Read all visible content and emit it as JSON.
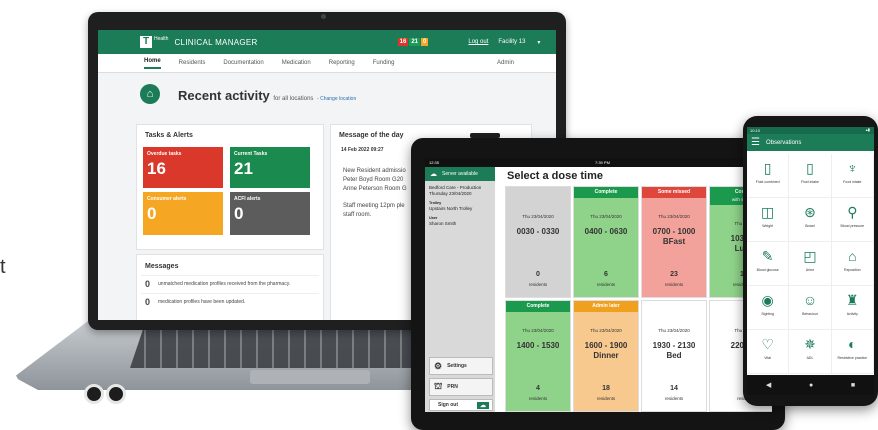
{
  "stray_text": "t",
  "colors": {
    "brand_green": "#1b7c57",
    "red": "#d9382a",
    "orange": "#f5a623",
    "gray": "#5c5c5c",
    "pink": "#f2928a",
    "light_green": "#8fd38a",
    "peach": "#f7c98f",
    "light_gray": "#d3d3d3"
  },
  "laptop": {
    "logo_letter": "T",
    "logo_sup": "Health",
    "app_name": "CLINICAL MANAGER",
    "badges": [
      {
        "text": "16",
        "color": "#d9382a"
      },
      {
        "text": "21",
        "color": "#1b9a5a"
      },
      {
        "text": "0",
        "color": "#f5a623"
      }
    ],
    "logout": "Log out",
    "facility": "Facility 13",
    "nav": [
      "Home",
      "Residents",
      "Documentation",
      "Medication",
      "Reporting",
      "Funding"
    ],
    "admin": "Admin",
    "heading": "Recent activity",
    "heading_sub": "for all locations",
    "change_location": "- Change location",
    "tasks_title": "Tasks & Alerts",
    "tiles": [
      {
        "label": "Overdue tasks",
        "value": "16"
      },
      {
        "label": "Current Tasks",
        "value": "21"
      },
      {
        "label": "Consumer alerts",
        "value": "0"
      },
      {
        "label": "ACFI alerts",
        "value": "0"
      }
    ],
    "messages_title": "Messages",
    "messages": [
      {
        "count": "0",
        "text": "unmatched medication profiles received from the pharmacy."
      },
      {
        "count": "0",
        "text": "medication profiles have been updated."
      }
    ],
    "motd_title": "Message of the day",
    "motd_date": "14 Feb 2022 09:27",
    "motd_lines": [
      "New Resident admissio",
      "Peter Boyd Room G20",
      "Anne Peterson Room G"
    ],
    "motd_extra": [
      "Staff meeting 12pm ple",
      "staff room."
    ]
  },
  "tablet": {
    "status_left": "12:35",
    "status_time": "7:39 PM",
    "server": "Server available",
    "facility": "Bedford Care - Production",
    "date": "Thursday 23/04/2020",
    "trolley_label": "Trolley",
    "trolley": "Upstairs North Trolley",
    "user_label": "User",
    "user": "Sharon Smith",
    "settings": "Settings",
    "prn": "PRN",
    "sign_out": "Sign out",
    "title": "Select a dose time",
    "rounds": [
      {
        "status": "",
        "date": "Thu 23/04/2020",
        "time": "0030 - 0330",
        "name": "",
        "count": "0",
        "residents": "residents",
        "state": "gray"
      },
      {
        "status": "Complete",
        "date": "Thu 23/04/2020",
        "time": "0400 - 0630",
        "name": "",
        "count": "6",
        "residents": "residents",
        "state": "complete"
      },
      {
        "status": "Some missed",
        "date": "Thu 23/04/2020",
        "time": "0700 - 1000",
        "name": "BFast",
        "count": "23",
        "residents": "residents",
        "state": "missed"
      },
      {
        "status": "Comp",
        "status2": "with some",
        "date": "Thu 23/",
        "time": "1030 -",
        "name": "Lun",
        "count": "1",
        "residents": "residents",
        "state": "complete"
      },
      {
        "status": "Complete",
        "date": "Thu 23/04/2020",
        "time": "1400 - 1530",
        "name": "",
        "count": "4",
        "residents": "residents",
        "state": "complete"
      },
      {
        "status": "Admin later",
        "date": "Thu 23/04/2020",
        "time": "1600 - 1900",
        "name": "Dinner",
        "count": "18",
        "residents": "residents",
        "state": "later"
      },
      {
        "status": "",
        "date": "Thu 23/04/2020",
        "time": "1930 - 2130",
        "name": "Bed",
        "count": "14",
        "residents": "residents",
        "state": "none"
      },
      {
        "status": "",
        "date": "Thu 23/",
        "time": "2200 -",
        "name": "",
        "count": "",
        "residents": "resid",
        "state": "none"
      }
    ]
  },
  "phone": {
    "status_time": "10:10",
    "title": "Observations",
    "items": [
      {
        "label": "Fluid combined",
        "icon": "fluid-combined-icon",
        "glyph": "▯"
      },
      {
        "label": "Fluid intake",
        "icon": "fluid-intake-icon",
        "glyph": "▯"
      },
      {
        "label": "Food intake",
        "icon": "food-intake-icon",
        "glyph": "♆"
      },
      {
        "label": "Weight",
        "icon": "weight-icon",
        "glyph": "◫"
      },
      {
        "label": "Bowel",
        "icon": "bowel-icon",
        "glyph": "⊛"
      },
      {
        "label": "Blood pressure",
        "icon": "blood-pressure-icon",
        "glyph": "⚲"
      },
      {
        "label": "Blood glucose",
        "icon": "blood-glucose-icon",
        "glyph": "✎"
      },
      {
        "label": "Urine",
        "icon": "urine-icon",
        "glyph": "◰"
      },
      {
        "label": "Reposition",
        "icon": "reposition-icon",
        "glyph": "⌂"
      },
      {
        "label": "Sighting",
        "icon": "sighting-icon",
        "glyph": "◉"
      },
      {
        "label": "Behaviour",
        "icon": "behaviour-icon",
        "glyph": "☺"
      },
      {
        "label": "Activity",
        "icon": "activity-icon",
        "glyph": "♜"
      },
      {
        "label": "Vital",
        "icon": "vital-icon",
        "glyph": "♡"
      },
      {
        "label": "ADL",
        "icon": "adl-icon",
        "glyph": "✵"
      },
      {
        "label": "Restrictive practice",
        "icon": "restrictive-practice-icon",
        "glyph": "◐"
      }
    ],
    "nav": [
      "◀",
      "●",
      "■"
    ]
  }
}
